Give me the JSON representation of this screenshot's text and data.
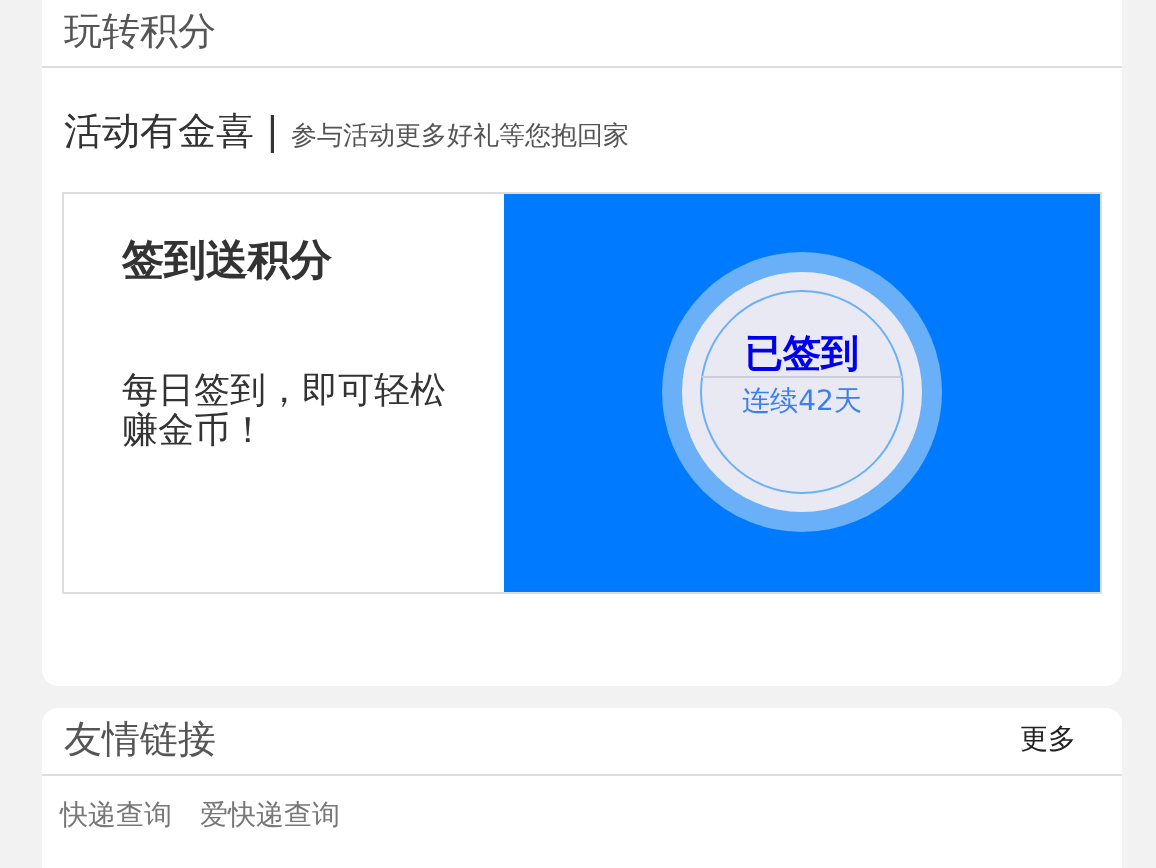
{
  "points_card": {
    "title": "玩转积分",
    "activity": {
      "title": "活动有金喜",
      "separator": "|",
      "subtitle": "参与活动更多好礼等您抱回家"
    },
    "signin": {
      "title": "签到送积分",
      "description": "每日签到，即可轻松赚金币！",
      "status": "已签到",
      "streak": "连续42天"
    }
  },
  "links_card": {
    "title": "友情链接",
    "more": "更多",
    "links": [
      "快递查询",
      "爱快递查询"
    ]
  }
}
